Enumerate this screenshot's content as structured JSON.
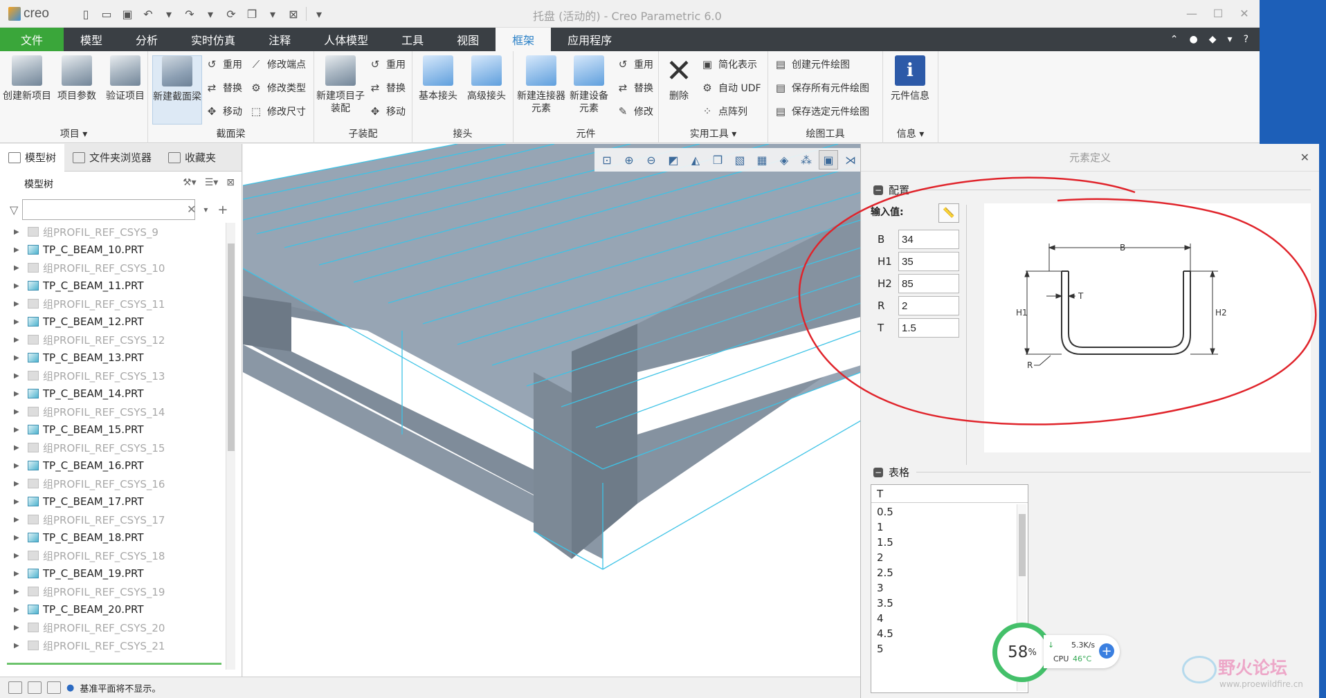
{
  "app": {
    "logo": "creo",
    "window_title": "托盘 (活动的) - Creo Parametric 6.0"
  },
  "tabs": [
    {
      "label": "文件"
    },
    {
      "label": "模型"
    },
    {
      "label": "分析"
    },
    {
      "label": "实时仿真"
    },
    {
      "label": "注释"
    },
    {
      "label": "人体模型"
    },
    {
      "label": "工具"
    },
    {
      "label": "视图"
    },
    {
      "label": "框架"
    },
    {
      "label": "应用程序"
    }
  ],
  "active_tab": "框架",
  "ribbon": {
    "items_group": {
      "title": "项目",
      "create_new": "创建新项目",
      "project_params": "项目参数",
      "validate": "验证项目"
    },
    "section_beam_group": {
      "title": "截面梁",
      "new_section_beam": "新建截面梁",
      "reuse": "重用",
      "replace": "替换",
      "move": "移动",
      "modify_endpoint": "修改端点",
      "modify_type": "修改类型",
      "modify_size": "修改尺寸"
    },
    "subassembly_group": {
      "title": "子装配",
      "new_project_subasm": "新建项目子装配",
      "reuse": "重用",
      "replace": "替换",
      "move": "移动"
    },
    "joint_group": {
      "title": "接头",
      "basic_joint": "基本接头",
      "advanced_joint": "高级接头"
    },
    "element_group": {
      "title": "元件",
      "new_connector": "新建连接器元素",
      "new_device": "新建设备元素",
      "reuse": "重用",
      "replace": "替换",
      "modify": "修改"
    },
    "utility_group": {
      "title": "实用工具",
      "delete": "删除",
      "simplified_rep": "简化表示",
      "auto_udf": "自动 UDF",
      "point_pattern": "点阵列"
    },
    "drawing_group": {
      "title": "绘图工具",
      "create_drawing": "创建元件绘图",
      "save_all": "保存所有元件绘图",
      "save_selected": "保存选定元件绘图"
    },
    "info_group": {
      "title": "信息",
      "element_info": "元件信息"
    }
  },
  "left_panel": {
    "tabs": [
      "模型树",
      "文件夹浏览器",
      "收藏夹"
    ],
    "tree_header": "模型树",
    "filter_placeholder": "",
    "tree_items": [
      {
        "label": "组PROFIL_REF_CSYS_9",
        "kind": "grp"
      },
      {
        "label": "TP_C_BEAM_10.PRT",
        "kind": "part"
      },
      {
        "label": "组PROFIL_REF_CSYS_10",
        "kind": "grp"
      },
      {
        "label": "TP_C_BEAM_11.PRT",
        "kind": "part"
      },
      {
        "label": "组PROFIL_REF_CSYS_11",
        "kind": "grp"
      },
      {
        "label": "TP_C_BEAM_12.PRT",
        "kind": "part"
      },
      {
        "label": "组PROFIL_REF_CSYS_12",
        "kind": "grp"
      },
      {
        "label": "TP_C_BEAM_13.PRT",
        "kind": "part"
      },
      {
        "label": "组PROFIL_REF_CSYS_13",
        "kind": "grp"
      },
      {
        "label": "TP_C_BEAM_14.PRT",
        "kind": "part"
      },
      {
        "label": "组PROFIL_REF_CSYS_14",
        "kind": "grp"
      },
      {
        "label": "TP_C_BEAM_15.PRT",
        "kind": "part"
      },
      {
        "label": "组PROFIL_REF_CSYS_15",
        "kind": "grp"
      },
      {
        "label": "TP_C_BEAM_16.PRT",
        "kind": "part"
      },
      {
        "label": "组PROFIL_REF_CSYS_16",
        "kind": "grp"
      },
      {
        "label": "TP_C_BEAM_17.PRT",
        "kind": "part"
      },
      {
        "label": "组PROFIL_REF_CSYS_17",
        "kind": "grp"
      },
      {
        "label": "TP_C_BEAM_18.PRT",
        "kind": "part"
      },
      {
        "label": "组PROFIL_REF_CSYS_18",
        "kind": "grp"
      },
      {
        "label": "TP_C_BEAM_19.PRT",
        "kind": "part"
      },
      {
        "label": "组PROFIL_REF_CSYS_19",
        "kind": "grp"
      },
      {
        "label": "TP_C_BEAM_20.PRT",
        "kind": "part"
      },
      {
        "label": "组PROFIL_REF_CSYS_20",
        "kind": "grp"
      },
      {
        "label": "组PROFIL_REF_CSYS_21",
        "kind": "grp"
      }
    ]
  },
  "status": {
    "message": "基准平面将不显示。"
  },
  "dialog": {
    "title": "元素定义",
    "config_section": "配置",
    "input_label": "输入值:",
    "params": [
      {
        "name": "B",
        "value": "34"
      },
      {
        "name": "H1",
        "value": "35"
      },
      {
        "name": "H2",
        "value": "85"
      },
      {
        "name": "R",
        "value": "2"
      },
      {
        "name": "T",
        "value": "1.5"
      }
    ],
    "diagram_labels": {
      "b": "B",
      "h1": "H1",
      "h2": "H2",
      "t": "T",
      "r": "R"
    },
    "table_section": "表格",
    "table_header": "T",
    "table_values": [
      "0.5",
      "1",
      "1.5",
      "2",
      "2.5",
      "3",
      "3.5",
      "4",
      "4.5",
      "5"
    ]
  },
  "cpu_widget": {
    "percent": "58",
    "percent_sign": "%",
    "net_rate": "5.3K/s",
    "cpu_label": "CPU",
    "cpu_temp": "46°C"
  },
  "watermark": {
    "text": "野火论坛",
    "url": "www.proewildfire.cn"
  },
  "colors": {
    "accent": "#2a80c7",
    "file_tab": "#3aa63a",
    "annotation": "#e0242b",
    "model_edge": "#3ec3e6"
  }
}
